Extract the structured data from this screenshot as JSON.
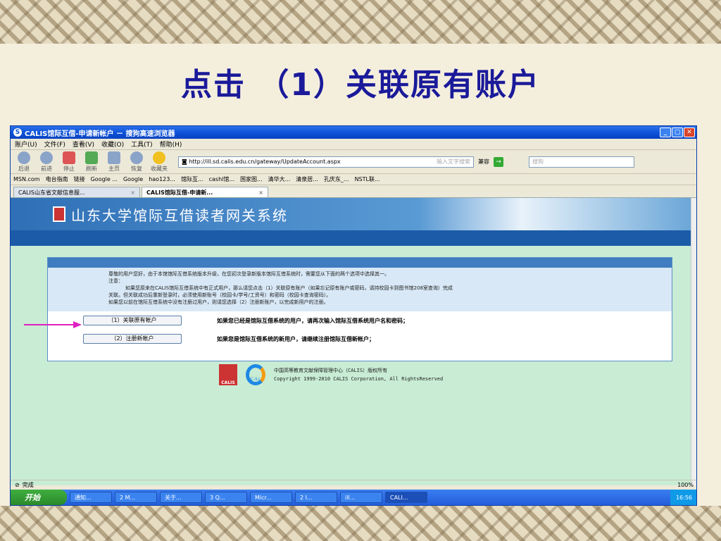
{
  "slide": {
    "title": "点击 （1）关联原有账户"
  },
  "browser": {
    "window_title": "CALIS馆际互借-申请新帐户 － 搜狗高速浏览器",
    "menu": [
      "账户(U)",
      "文件(F)",
      "查看(V)",
      "收藏(O)",
      "工具(T)",
      "帮助(H)"
    ],
    "toolbar": {
      "back": "后退",
      "forward": "前进",
      "stop": "停止",
      "refresh": "刷新",
      "home": "主页",
      "restore": "恢复",
      "favorites": "收藏夹"
    },
    "address": {
      "url": "http://ill.sd.calis.edu.cn/gateway/UpdateAccount.aspx",
      "hint": "输入文字搜索"
    },
    "compat_label": "兼容",
    "search_placeholder": "搜狗",
    "favorites": [
      "MSN.com",
      "电台指南",
      "链接",
      "Google ...",
      "Google",
      "hao123...",
      "馆际互...",
      "cashl馆...",
      "国家图...",
      "清华大...",
      "清泉居...",
      "孔庆东_...",
      "NSTL联..."
    ],
    "tabs": [
      {
        "label": "CALIS山东省文献信息服..."
      },
      {
        "label": "CALIS馆际互借-申请新..."
      }
    ],
    "status": {
      "text": "完成",
      "zoom": "100%"
    }
  },
  "page": {
    "banner_title": "山东大学馆际互借读者网关系统",
    "notice": {
      "line1": "尊敬的用户您好，由于本馆馆际互借系统版本升级，在您初次登录新版本馆际互借系统时，需要您从下面的两个选项中选择其一。",
      "line2": "注意：",
      "line3": "如果您原来在CALIS馆际互借系统中有正式用户，那么请您点击（1）关联原有账户（如果忘记原有账户或密码，请持校园卡到图书馆208室查询）完成",
      "line4": "关联。但关联成功后重新登录时，必须使用新账号（校园卡/学号/工资号）和密码（校园卡查询密码）。",
      "line5": "如果您以前在馆际互借系统中没有注册过用户，则请您选择（2）注册新账户，以完成新用户的注册。"
    },
    "option1": {
      "button": "（1）关联原有帐户",
      "desc": "如果您已经是馆际互借系统的用户，请再次输入馆际互借系统用户名和密码；"
    },
    "option2": {
      "button": "（2）注册新帐户",
      "desc": "如果您是馆际互借系统的新用户，请继续注册馆际互借新帐户；"
    },
    "footer": {
      "logo1": "CALIS",
      "logo2": "C-ILL",
      "line1": "中国高等教育文献保障管理中心（CALIS）版权所有",
      "line2": "Copyright 1999-2010 CALIS Corporation, All RightsReserved"
    }
  },
  "taskbar": {
    "start": "开始",
    "tasks": [
      "通知...",
      "2 M...",
      "关于...",
      "3 Q...",
      "Micr...",
      "2 I...",
      "ill...",
      "CALI..."
    ],
    "clock": "16:56"
  },
  "colors": {
    "title": "#1a1a9a",
    "arrow": "#e020c0",
    "page_bg": "#c8ecd4",
    "banner": "#2e6fb6"
  }
}
